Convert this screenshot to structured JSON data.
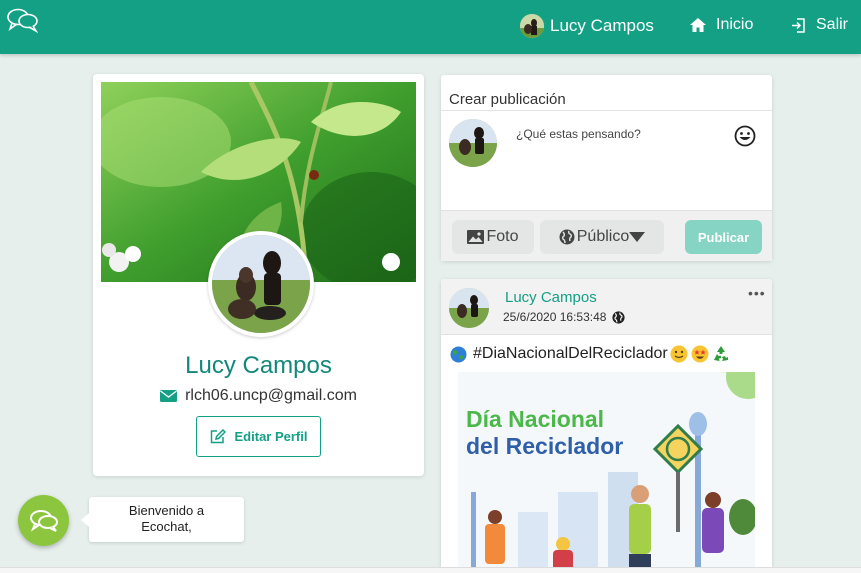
{
  "navbar": {
    "user_name": "Lucy Campos",
    "home_label": "Inicio",
    "logout_label": "Salir",
    "color": "#13a085"
  },
  "profile": {
    "name": "Lucy Campos",
    "email": "rlch06.uncp@gmail.com",
    "edit_label": "Editar Perfil"
  },
  "create_post": {
    "title": "Crear publicación",
    "placeholder": "¿Qué estas pensando?",
    "photo_label": "Foto",
    "privacy_label": "Público",
    "publish_label": "Publicar"
  },
  "post": {
    "author": "Lucy Campos",
    "date": "25/6/2020 16:53:48",
    "text": "#DiaNacionalDelReciclador",
    "image_title_line1": "Día Nacional",
    "image_title_line2": "del Reciclador"
  },
  "chat": {
    "welcome_line1": "Bienvenido a",
    "welcome_line2": "Ecochat,"
  },
  "icons": {
    "logo": "chat-bubbles-icon",
    "home": "home-icon",
    "logout": "logout-icon",
    "email": "envelope-icon",
    "edit": "edit-icon",
    "emoji": "smiley-icon",
    "photo": "image-icon",
    "privacy": "globe-icon",
    "chat": "chat-icon"
  },
  "colors": {
    "primary": "#13a085",
    "accent_green": "#8cc63f",
    "publish_disabled": "#86d4c4",
    "background": "#e6efec"
  }
}
